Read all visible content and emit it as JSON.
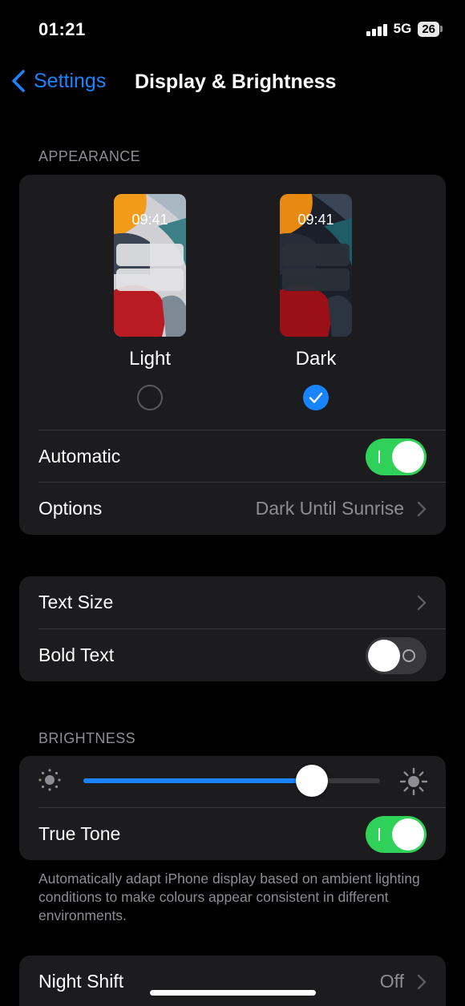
{
  "status_bar": {
    "time": "01:21",
    "network": "5G",
    "battery": "26"
  },
  "nav": {
    "back_label": "Settings",
    "title": "Display & Brightness"
  },
  "appearance": {
    "header": "APPEARANCE",
    "light": {
      "label": "Light",
      "preview_time": "09:41",
      "selected": false
    },
    "dark": {
      "label": "Dark",
      "preview_time": "09:41",
      "selected": true
    },
    "automatic_label": "Automatic",
    "automatic_on": true,
    "options_label": "Options",
    "options_value": "Dark Until Sunrise"
  },
  "text": {
    "text_size_label": "Text Size",
    "bold_text_label": "Bold Text",
    "bold_text_on": false
  },
  "brightness": {
    "header": "BRIGHTNESS",
    "level": 0.77,
    "true_tone_label": "True Tone",
    "true_tone_on": true,
    "footnote": "Automatically adapt iPhone display based on ambient lighting conditions to make colours appear consistent in different environments."
  },
  "night_shift": {
    "label": "Night Shift",
    "value": "Off"
  },
  "colors": {
    "accent": "#1a84ff",
    "toggle_on": "#30d158",
    "group_bg": "#1c1c1e",
    "secondary_text": "#8d8d93"
  }
}
